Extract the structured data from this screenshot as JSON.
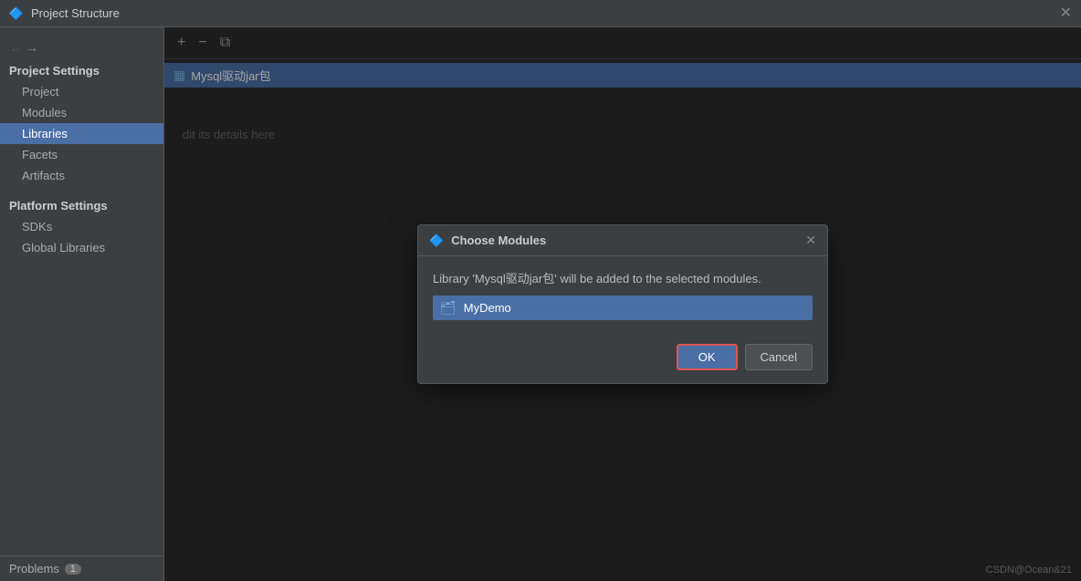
{
  "titlebar": {
    "icon": "🔷",
    "title": "Project Structure",
    "close_label": "✕"
  },
  "sidebar": {
    "nav_arrows": {
      "back": "←",
      "forward": "→"
    },
    "project_settings_header": "Project Settings",
    "items": [
      {
        "id": "project",
        "label": "Project",
        "active": false
      },
      {
        "id": "modules",
        "label": "Modules",
        "active": false
      },
      {
        "id": "libraries",
        "label": "Libraries",
        "active": true
      },
      {
        "id": "facets",
        "label": "Facets",
        "active": false
      },
      {
        "id": "artifacts",
        "label": "Artifacts",
        "active": false
      }
    ],
    "platform_settings_header": "Platform Settings",
    "platform_items": [
      {
        "id": "sdks",
        "label": "SDKs"
      },
      {
        "id": "global-libraries",
        "label": "Global Libraries"
      }
    ],
    "problems_label": "Problems",
    "problems_count": "1"
  },
  "toolbar": {
    "add_btn": "+",
    "remove_btn": "−",
    "copy_btn": "⧉"
  },
  "library_list": {
    "items": [
      {
        "icon": "▦",
        "label": "Mysql驱动jar包"
      }
    ]
  },
  "right_hint": "dit its details here",
  "dialog": {
    "title": "Choose Modules",
    "close_label": "✕",
    "icon": "🔷",
    "message": "Library 'Mysql驱动jar包' will be added to the selected modules.",
    "module_icon": "📁",
    "module_label": "MyDemo",
    "ok_label": "OK",
    "cancel_label": "Cancel"
  },
  "watermark": "CSDN@Ocean&21"
}
